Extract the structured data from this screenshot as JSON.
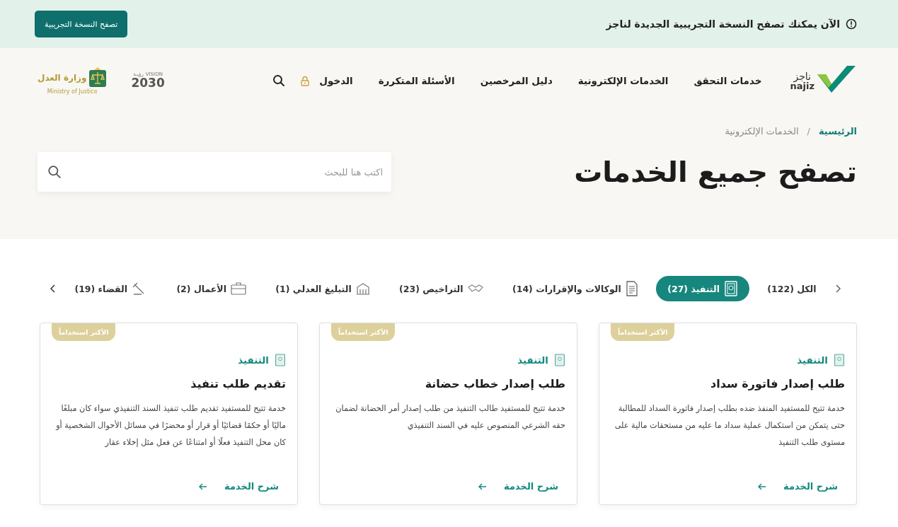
{
  "announcement": {
    "text": "الآن يمكنك تصفح النسخة التجريبية الجديدة لناجز",
    "button": "تصفح النسخة التجريبية"
  },
  "header": {
    "brand": {
      "name_ar": "ناجز",
      "name_en": "najiz"
    },
    "nav": [
      "خدمات التحقق",
      "الخدمات الإلكترونية",
      "دليل المرخصين",
      "الأسئلة المتكررة"
    ],
    "login": "الدخول",
    "vision": {
      "ar": "رؤيـة",
      "en": "VISION",
      "year": "2030"
    },
    "ministry": {
      "ar": "وزارة العدل",
      "en": "Ministry of Justice"
    }
  },
  "breadcrumb_separator": "/",
  "breadcrumb": [
    {
      "label": "الرئيسية",
      "current": false
    },
    {
      "label": "الخدمات الإلكترونية",
      "current": true
    }
  ],
  "page_title": "تصفح جميع الخدمات",
  "search": {
    "placeholder": "اكتب هنا للبحث"
  },
  "tabs": [
    {
      "label": "الكل (122)",
      "selected": false
    },
    {
      "label": "التنفيذ (27)",
      "selected": true
    },
    {
      "label": "الوكالات والإقرارات (14)",
      "selected": false
    },
    {
      "label": "التراخيص (23)",
      "selected": false
    },
    {
      "label": "التبليغ العدلي (1)",
      "selected": false
    },
    {
      "label": "الأعمال (2)",
      "selected": false
    },
    {
      "label": "القضاء (19)",
      "selected": false
    }
  ],
  "cards": [
    {
      "badge": "الأكثر استخداماً",
      "category": "التنفيذ",
      "title": "طلب إصدار فاتورة سداد",
      "description": "خدمة تتيح للمستفيد المنفذ ضده بطلب إصدار فاتورة السداد للمطالبة حتى يتمكن من استكمال عملية سداد ما عليه من مستحقات مالية على مستوى طلب التنفيذ",
      "link": "شرح الخدمة"
    },
    {
      "badge": "الأكثر استخداماً",
      "category": "التنفيذ",
      "title": "طلب إصدار خطاب حضانة",
      "description": "خدمة تتيح للمستفيد طالب التنفيذ من طلب إصدار أمر الحضانة لضمان حقه الشرعي المنصوص عليه في السند التنفيذي",
      "link": "شرح الخدمة"
    },
    {
      "badge": "الأكثر استخداماً",
      "category": "التنفيذ",
      "title": "تقديم طلب تنفيذ",
      "description": "خدمة تتيح للمستفيد تقديم طلب تنفيذ السند التنفيذي سواء كان مبلغًا ماليًا أو حكمًا قضائيًا أو قرار أو محضرًا في مسائل الأحوال الشخصية أو كان محل التنفيذ فعلًا أو امتناعًا عن فعل مثل إخلاء عقار",
      "link": "شرح الخدمة"
    }
  ]
}
